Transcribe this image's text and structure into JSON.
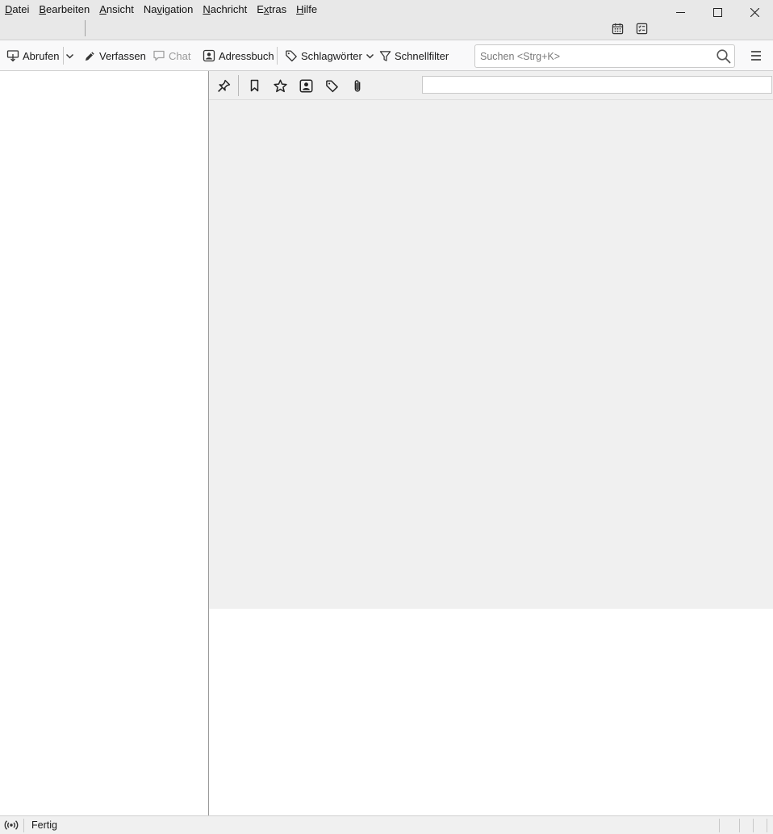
{
  "menubar": {
    "items": [
      {
        "pre": "",
        "u": "D",
        "post": "atei"
      },
      {
        "pre": "",
        "u": "B",
        "post": "earbeiten"
      },
      {
        "pre": "",
        "u": "A",
        "post": "nsicht"
      },
      {
        "pre": "Na",
        "u": "v",
        "post": "igation"
      },
      {
        "pre": "",
        "u": "N",
        "post": "achricht"
      },
      {
        "pre": "E",
        "u": "x",
        "post": "tras"
      },
      {
        "pre": "",
        "u": "H",
        "post": "ilfe"
      }
    ]
  },
  "tabbar": {
    "icons": [
      "calendar-icon",
      "tasks-icon"
    ]
  },
  "window_controls": [
    "minimize-icon",
    "maximize-icon",
    "close-icon"
  ],
  "toolbar": {
    "get_messages_label": "Abrufen",
    "compose_label": "Verfassen",
    "chat_label": "Chat",
    "address_book_label": "Adressbuch",
    "tags_label": "Schlagwörter",
    "quick_filter_label": "Schnellfilter",
    "search_placeholder": "Suchen <Strg+K>",
    "search_value": ""
  },
  "quick_filter_bar": {
    "icons": [
      "sticky-pin-icon",
      "unread-icon",
      "starred-icon",
      "contact-icon",
      "tag-icon",
      "attachment-icon"
    ],
    "filter_value": ""
  },
  "status_bar": {
    "text": "Fertig",
    "icon": "online-status-icon"
  },
  "colors": {
    "titlebar": "#e8e8e8",
    "toolbar": "#f9f9fa",
    "thread_pane": "#f0f0f0",
    "status_bar": "#f0f0f0"
  }
}
